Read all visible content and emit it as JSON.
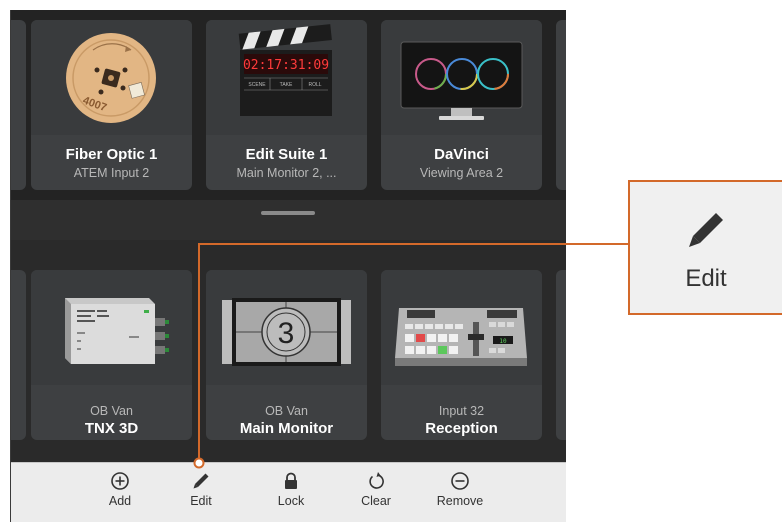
{
  "top_cards": [
    {
      "title": "Fiber Optic 1",
      "subtitle": "ATEM Input 2",
      "icon": "fiber-reel-icon"
    },
    {
      "title": "Edit Suite 1",
      "subtitle": "Main Monitor 2, ...",
      "icon": "clapperboard-icon"
    },
    {
      "title": "DaVinci",
      "subtitle": "Viewing Area 2",
      "icon": "color-monitor-icon"
    }
  ],
  "bottom_cards": [
    {
      "subtitle": "OB Van",
      "title": "TNX 3D",
      "icon": "converter-box-icon"
    },
    {
      "subtitle": "OB Van",
      "title": "Main Monitor",
      "icon": "countdown-monitor-icon"
    },
    {
      "subtitle": "Input 32",
      "title": "Reception",
      "icon": "switcher-panel-icon"
    }
  ],
  "clapper_timecode": "02:17:31:09",
  "clapper_fields": [
    "SCENE",
    "TAKE",
    "ROLL"
  ],
  "reel_number": "4007",
  "countdown_digit": "3",
  "toolbar": {
    "add": "Add",
    "edit": "Edit",
    "lock": "Lock",
    "clear": "Clear",
    "remove": "Remove"
  },
  "callout": {
    "label": "Edit"
  },
  "colors": {
    "accent": "#d3692a",
    "card": "#3e4042",
    "toolbar": "#ececec"
  }
}
